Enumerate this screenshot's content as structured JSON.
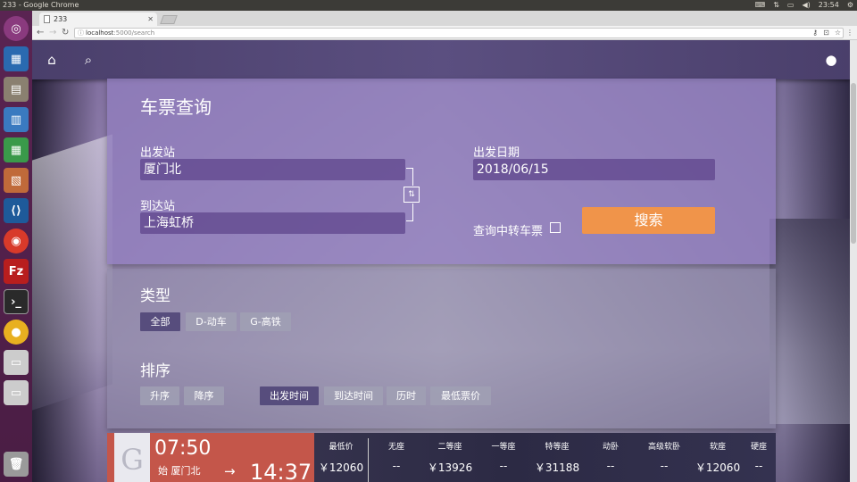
{
  "os": {
    "window_title": "233 - Google Chrome",
    "clock": "23:54"
  },
  "browser": {
    "tab_title": "233",
    "url_host": "localhost",
    "url_path": ":5000/search"
  },
  "form": {
    "title": "车票查询",
    "from_label": "出发站",
    "from_value": "厦门北",
    "to_label": "到达站",
    "to_value": "上海虹桥",
    "date_label": "出发日期",
    "date_value": "2018/06/15",
    "swap_glyph": "⇅",
    "transfer_label": "查询中转车票",
    "search_button": "搜索"
  },
  "filters": {
    "type_title": "类型",
    "types": [
      "全部",
      "D-动车",
      "G-高铁"
    ],
    "sort_title": "排序",
    "order": [
      "升序",
      "降序"
    ],
    "sort_by": [
      "出发时间",
      "到达时间",
      "历时",
      "最低票价"
    ]
  },
  "result": {
    "train_letter": "G",
    "depart_time": "07:50",
    "depart_station": "始 厦门北",
    "arrow": "→",
    "arrive_time": "14:37",
    "seats": [
      {
        "head": "最低价",
        "val": "￥12060"
      },
      {
        "head": "无座",
        "val": "--"
      },
      {
        "head": "二等座",
        "val": "￥13926"
      },
      {
        "head": "一等座",
        "val": "--"
      },
      {
        "head": "特等座",
        "val": "￥31188"
      },
      {
        "head": "动卧",
        "val": "--"
      },
      {
        "head": "高级软卧",
        "val": "--"
      },
      {
        "head": "软座",
        "val": "￥12060"
      },
      {
        "head": "硬座",
        "val": "--"
      }
    ]
  }
}
